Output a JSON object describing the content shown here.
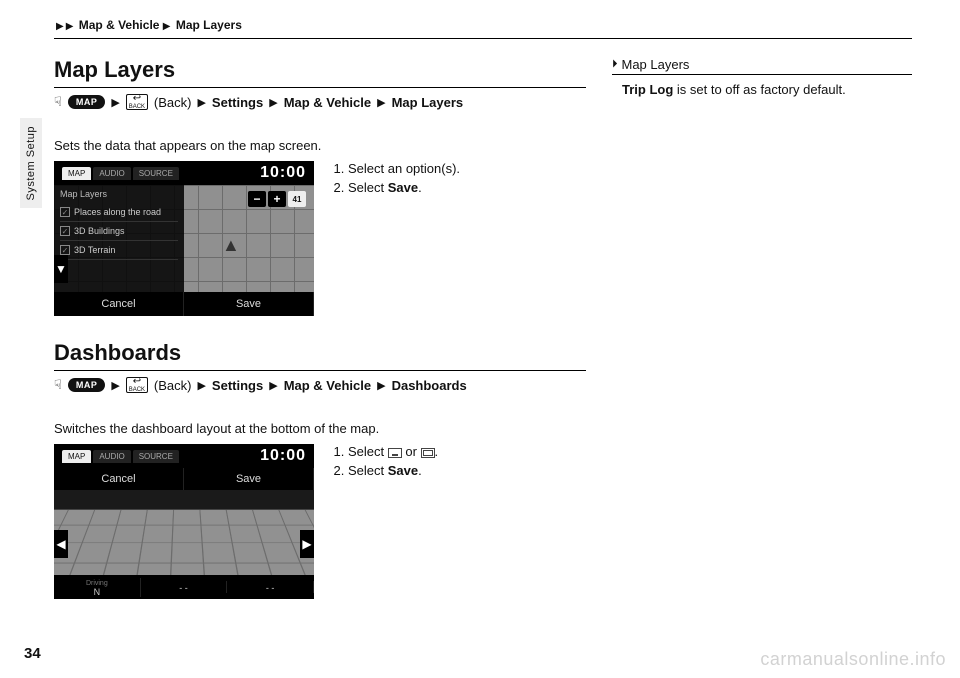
{
  "breadcrumb": {
    "a": "Map & Vehicle",
    "b": "Map Layers"
  },
  "side_tab": "System Setup",
  "sec1": {
    "title": "Map Layers",
    "path": {
      "map_btn": "MAP",
      "back": "(Back)",
      "settings": "Settings",
      "mv": "Map & Vehicle",
      "leaf": "Map Layers"
    },
    "desc": "Sets the data that appears on the map screen.",
    "steps": {
      "s1_pre": "Select an option(s).",
      "s2_pre": "Select ",
      "s2_b": "Save",
      "s2_post": "."
    },
    "shot": {
      "tabs": {
        "map": "MAP",
        "audio": "AUDIO",
        "source": "SOURCE"
      },
      "clock": "10:00",
      "panel_title": "Map Layers",
      "items": [
        "Places along the road",
        "3D Buildings",
        "3D Terrain"
      ],
      "cancel": "Cancel",
      "save": "Save",
      "badge": "41"
    }
  },
  "sec2": {
    "title": "Dashboards",
    "path": {
      "map_btn": "MAP",
      "back": "(Back)",
      "settings": "Settings",
      "mv": "Map & Vehicle",
      "leaf": "Dashboards"
    },
    "desc": "Switches the dashboard layout at the bottom of the map.",
    "steps": {
      "s1_pre": "Select ",
      "s1_mid": " or ",
      "s1_post": ".",
      "s2_pre": "Select ",
      "s2_b": "Save",
      "s2_post": "."
    },
    "shot": {
      "tabs": {
        "map": "MAP",
        "audio": "AUDIO",
        "source": "SOURCE"
      },
      "clock": "10:00",
      "cancel": "Cancel",
      "save": "Save",
      "dash": {
        "driving_lbl": "Driving",
        "driving_val": "N",
        "seg2": "- -",
        "seg3": "- -"
      }
    }
  },
  "right": {
    "head": "Map Layers",
    "body_b": "Trip Log",
    "body_rest": " is set to off as factory default."
  },
  "page_number": "34",
  "watermark": "carmanualsonline.info"
}
